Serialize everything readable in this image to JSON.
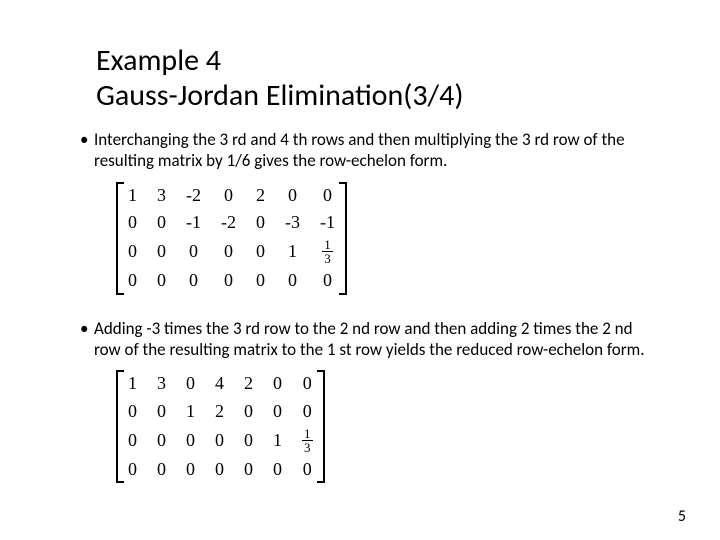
{
  "title_line1": "Example 4",
  "title_line2": "Gauss-Jordan Elimination(3/4)",
  "bullet1": "Interchanging the 3 rd and 4 th rows and then multiplying the 3 rd row of the resulting matrix by 1/6 gives the row-echelon form.",
  "bullet2": "Adding -3 times the 3 rd row to the 2 nd row and then adding 2 times the 2 nd row of the resulting matrix to the 1 st row yields the reduced row-echelon form.",
  "page_number": "5",
  "matrix1": [
    [
      "1",
      "3",
      "-2",
      "0",
      "2",
      "0",
      "0"
    ],
    [
      "0",
      "0",
      "-1",
      "-2",
      "0",
      "-3",
      "-1"
    ],
    [
      "0",
      "0",
      "0",
      "0",
      "0",
      "1",
      "1/3"
    ],
    [
      "0",
      "0",
      "0",
      "0",
      "0",
      "0",
      "0"
    ]
  ],
  "matrix2": [
    [
      "1",
      "3",
      "0",
      "4",
      "2",
      "0",
      "0"
    ],
    [
      "0",
      "0",
      "1",
      "2",
      "0",
      "0",
      "0"
    ],
    [
      "0",
      "0",
      "0",
      "0",
      "0",
      "1",
      "1/3"
    ],
    [
      "0",
      "0",
      "0",
      "0",
      "0",
      "0",
      "0"
    ]
  ]
}
